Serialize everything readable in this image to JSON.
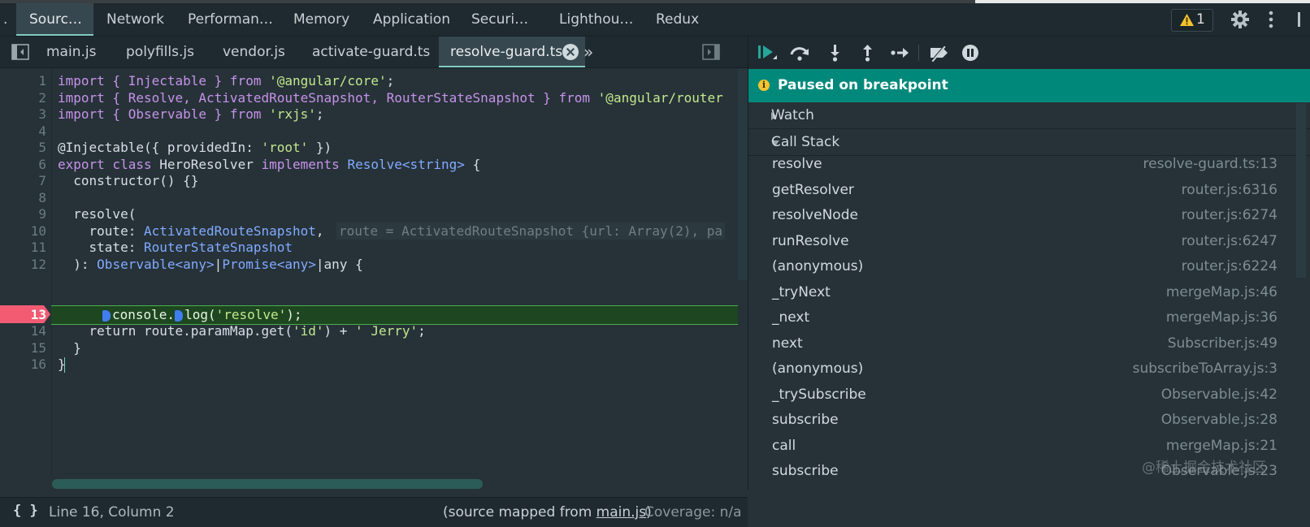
{
  "panel_tabs": [
    {
      "label": "Sourc…"
    },
    {
      "label": "Network"
    },
    {
      "label": "Performan…"
    },
    {
      "label": "Memory"
    },
    {
      "label": "Application"
    },
    {
      "label": "Securi…"
    },
    {
      "label": "Lighthou…"
    },
    {
      "label": "Redux"
    }
  ],
  "panel_tabs_overflow": ".",
  "warnings_count": "1",
  "file_tabs": [
    {
      "label": "main.js"
    },
    {
      "label": "polyfills.js"
    },
    {
      "label": "vendor.js"
    },
    {
      "label": "activate-guard.ts"
    },
    {
      "label": "resolve-guard.ts"
    }
  ],
  "file_tabs_more": "»",
  "editor": {
    "line_numbers": [
      "1",
      "2",
      "3",
      "4",
      "5",
      "6",
      "7",
      "8",
      "9",
      "10",
      "11",
      "12",
      "13",
      "14",
      "15",
      "16"
    ],
    "lines": {
      "l1a": "import { Injectable } from ",
      "l1b": "'@angular/core'",
      "l1c": ";",
      "l2a": "import { Resolve, ActivatedRouteSnapshot, RouterStateSnapshot } from ",
      "l2b": "'@angular/router",
      "l3a": "import { Observable } from ",
      "l3b": "'rxjs'",
      "l3c": ";",
      "l5a": "@Injectable({ providedIn: ",
      "l5b": "'root'",
      "l5c": " })",
      "l6a": "export class ",
      "l6b": "HeroResolver ",
      "l6c": "implements ",
      "l6d": "Resolve<string>",
      "l6e": " {",
      "l7": "  constructor() {}",
      "l9": "  resolve(",
      "l10a": "    route: ",
      "l10b": "ActivatedRouteSnapshot",
      "l10c": ",",
      "l10inline": "route = ActivatedRouteSnapshot {url: Array(2), pa",
      "l11a": "    state: ",
      "l11b": "RouterStateSnapshot",
      "l12a": "  ): ",
      "l12b": "Observable<any>",
      "l12c": "|",
      "l12d": "Promise<any>",
      "l12e": "|any {",
      "l13a": "console.",
      "l13b": "log(",
      "l13c": "'resolve'",
      "l13d": ");",
      "l14a": "    return route.paramMap.get(",
      "l14b": "'id'",
      "l14c": ") + ",
      "l14d": "' Jerry'",
      "l14e": ";",
      "l15": "  }",
      "l16": "}"
    },
    "breakpoint_line": "13"
  },
  "status": {
    "braces": "{ }",
    "position": "Line 16, Column 2",
    "source_prefix": "(source mapped from ",
    "source_file": "main.js",
    "source_suffix": ")",
    "coverage": "Coverage: n/a"
  },
  "debugger": {
    "paused_label": "Paused on breakpoint",
    "watch_label": "Watch",
    "callstack_label": "Call Stack",
    "frames": [
      {
        "fn": "resolve",
        "loc": "resolve-guard.ts:13"
      },
      {
        "fn": "getResolver",
        "loc": "router.js:6316"
      },
      {
        "fn": "resolveNode",
        "loc": "router.js:6274"
      },
      {
        "fn": "runResolve",
        "loc": "router.js:6247"
      },
      {
        "fn": "(anonymous)",
        "loc": "router.js:6224"
      },
      {
        "fn": "_tryNext",
        "loc": "mergeMap.js:46"
      },
      {
        "fn": "_next",
        "loc": "mergeMap.js:36"
      },
      {
        "fn": "next",
        "loc": "Subscriber.js:49"
      },
      {
        "fn": "(anonymous)",
        "loc": "subscribeToArray.js:3"
      },
      {
        "fn": "_trySubscribe",
        "loc": "Observable.js:42"
      },
      {
        "fn": "subscribe",
        "loc": "Observable.js:28"
      },
      {
        "fn": "call",
        "loc": "mergeMap.js:21"
      },
      {
        "fn": "subscribe",
        "loc": "Observable.js:23"
      }
    ]
  },
  "watermark": "@稀土掘金技术社区",
  "colors": {
    "accent": "#80cbc4",
    "paused_bg": "#00897b",
    "breakpoint": "#f25b72",
    "exec_line": "#1e4620"
  }
}
